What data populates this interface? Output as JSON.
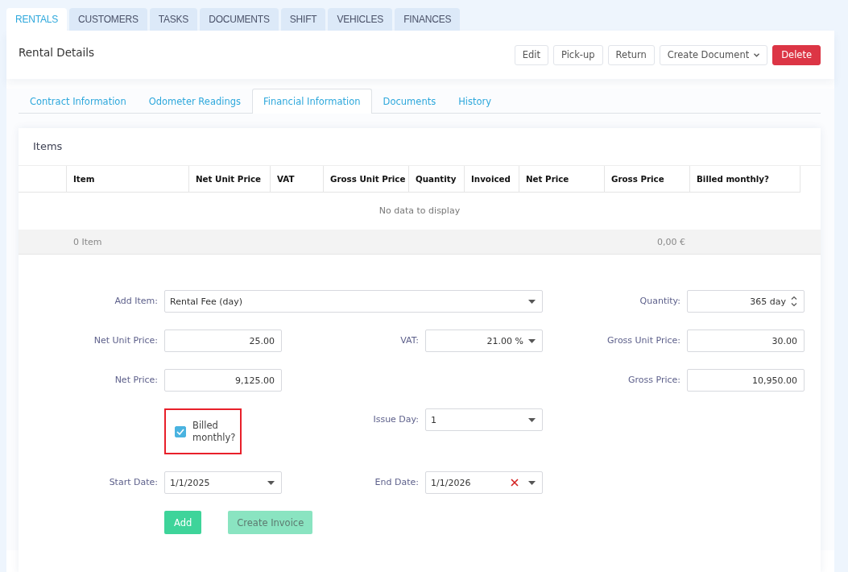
{
  "module_tabs": [
    {
      "label": "RENTALS",
      "selected": true
    },
    {
      "label": "CUSTOMERS",
      "selected": false
    },
    {
      "label": "TASKS",
      "selected": false
    },
    {
      "label": "DOCUMENTS",
      "selected": false
    },
    {
      "label": "SHIFT",
      "selected": false
    },
    {
      "label": "VEHICLES",
      "selected": false
    },
    {
      "label": "FINANCES",
      "selected": false
    }
  ],
  "page": {
    "title": "Rental Details",
    "actions": [
      {
        "label": "Edit",
        "kind": "plain"
      },
      {
        "label": "Pick-up",
        "kind": "plain"
      },
      {
        "label": "Return",
        "kind": "plain"
      },
      {
        "label": "Create Document",
        "kind": "dropdown"
      },
      {
        "label": "Delete",
        "kind": "danger"
      }
    ]
  },
  "sub_tabs": [
    {
      "label": "Contract Information",
      "selected": false
    },
    {
      "label": "Odometer Readings",
      "selected": false
    },
    {
      "label": "Financial Information",
      "selected": true
    },
    {
      "label": "Documents",
      "selected": false
    },
    {
      "label": "History",
      "selected": false
    }
  ],
  "items_panel": {
    "title": "Items",
    "table": {
      "columns": [
        "Item",
        "Net Unit Price",
        "VAT",
        "Gross Unit Price",
        "Quantity",
        "Invoiced",
        "Net Price",
        "Gross Price",
        "Billed monthly?"
      ],
      "empty_message": "No data to display",
      "footer": {
        "count": "0 Item",
        "total": "0,00 €"
      }
    }
  },
  "form": {
    "fields": [
      {
        "label": "Add Item:",
        "kind": "select",
        "value": "Rental Fee (day)"
      },
      {
        "label": "Quantity:",
        "kind": "spinner",
        "value": "365 day"
      },
      {
        "label": "Net Unit Price:",
        "kind": "number",
        "value": "25.00"
      },
      {
        "label": "VAT:",
        "kind": "number-select",
        "value": "21.00 %"
      },
      {
        "label": "Gross Unit Price:",
        "kind": "number",
        "value": "30.00"
      },
      {
        "label": "Net Price:",
        "kind": "number",
        "value": "9,125.00"
      },
      {
        "label": "Gross Price:",
        "kind": "number",
        "value": "10,950.00"
      },
      {
        "label": "Billed monthly?",
        "kind": "checkbox",
        "checked": true,
        "highlighted": true
      },
      {
        "label": "Issue Day:",
        "kind": "select",
        "value": "1"
      },
      {
        "label": "Start Date:",
        "kind": "date",
        "value": "1/1/2025"
      },
      {
        "label": "End Date:",
        "kind": "date",
        "value": "1/1/2026",
        "clearable": true
      }
    ],
    "buttons": [
      {
        "label": "Add",
        "disabled": false
      },
      {
        "label": "Create Invoice",
        "disabled": true
      }
    ]
  }
}
